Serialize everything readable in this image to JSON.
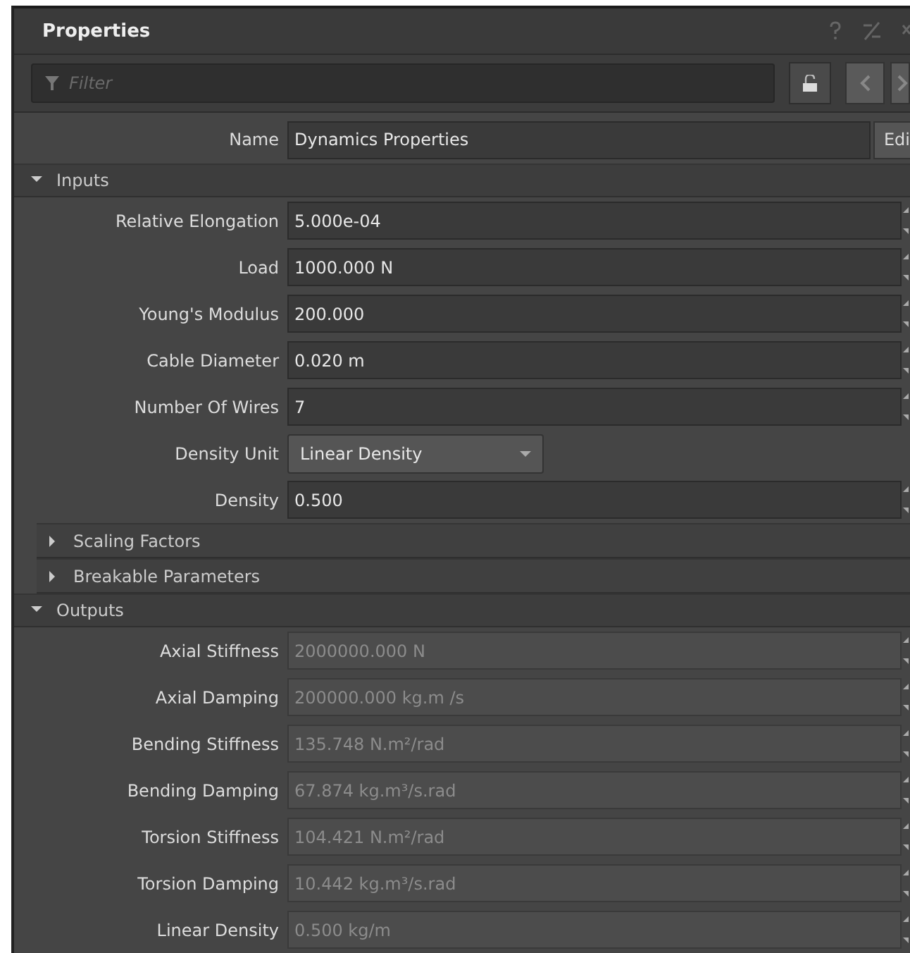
{
  "panel": {
    "title": "Properties",
    "filter": {
      "placeholder": "Filter"
    },
    "name_row": {
      "label": "Name",
      "value": "Dynamics Properties",
      "button": "Edi"
    },
    "sections": [
      {
        "title": "Inputs",
        "expanded": true,
        "rows": [
          {
            "kind": "spin",
            "label": "Relative Elongation",
            "value": "5.000e-04",
            "disabled": false
          },
          {
            "kind": "spin",
            "label": "Load",
            "value": "1000.000 N",
            "disabled": false
          },
          {
            "kind": "spin",
            "label": "Young's Modulus",
            "value": "200.000",
            "disabled": false
          },
          {
            "kind": "spin",
            "label": "Cable Diameter",
            "value": "0.020 m",
            "disabled": false
          },
          {
            "kind": "spin",
            "label": "Number Of Wires",
            "value": "7",
            "disabled": false
          },
          {
            "kind": "dropdown",
            "label": "Density Unit",
            "value": "Linear Density"
          },
          {
            "kind": "spin",
            "label": "Density",
            "value": "0.500",
            "disabled": false
          }
        ]
      },
      {
        "title": "Scaling Factors",
        "expanded": false
      },
      {
        "title": "Breakable Parameters",
        "expanded": false
      },
      {
        "title": "Outputs",
        "expanded": true,
        "rows": [
          {
            "kind": "spin",
            "label": "Axial Stiffness",
            "value": "2000000.000 N",
            "disabled": true
          },
          {
            "kind": "spin",
            "label": "Axial Damping",
            "value": "200000.000 kg.m /s",
            "disabled": true
          },
          {
            "kind": "spin",
            "label": "Bending Stiffness",
            "value": "135.748 N.m²/rad",
            "disabled": true
          },
          {
            "kind": "spin",
            "label": "Bending Damping",
            "value": "67.874 kg.m³/s.rad",
            "disabled": true
          },
          {
            "kind": "spin",
            "label": "Torsion Stiffness",
            "value": "104.421 N.m²/rad",
            "disabled": true
          },
          {
            "kind": "spin",
            "label": "Torsion Damping",
            "value": "10.442 kg.m³/s.rad",
            "disabled": true
          },
          {
            "kind": "spin",
            "label": "Linear Density",
            "value": "0.500 kg/m",
            "disabled": true
          }
        ]
      }
    ]
  }
}
